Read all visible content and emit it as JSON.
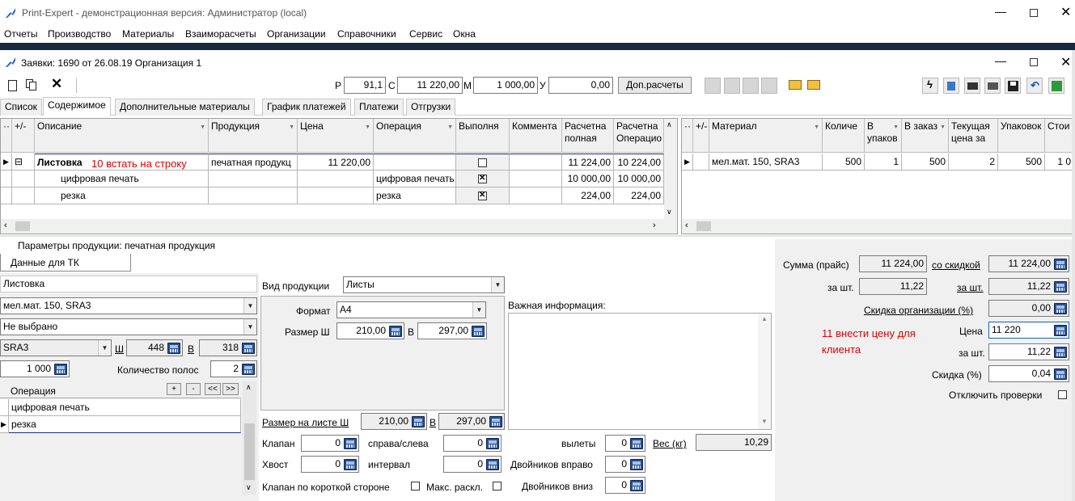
{
  "app_title": "Print-Expert - демонстрационная версия: Администратор (local)",
  "menu": [
    "Отчеты",
    "Производство",
    "Материалы",
    "Взаиморасчеты",
    "Организации",
    "Справочники",
    "Сервис",
    "Окна"
  ],
  "child_title": "Заявки: 1690 от 26.08.19  Организация 1",
  "toolbar": {
    "p_label": "Р",
    "p_value": "91,1",
    "c_label": "С",
    "c_value": "11 220,00",
    "m_label": "М",
    "m_value": "1 000,00",
    "u_label": "У",
    "u_value": "0,00",
    "dop_button": "Доп.расчеты"
  },
  "tabs": [
    "Список",
    "Содержимое",
    "Дополнительные материалы",
    "График платежей",
    "Платежи",
    "Отгрузки"
  ],
  "left_grid": {
    "headers": [
      "+/-",
      "Описание",
      "Продукция",
      "Цена",
      "Операция",
      "Выполня",
      "Коммента",
      "Расчетна полная",
      "Расчетна Операцио"
    ],
    "rows": [
      {
        "desc": "Листовка",
        "product": "печатная продукц",
        "price": "11 220,00",
        "op": "",
        "done": false,
        "calc_full": "11 224,00",
        "calc_op": "10 224,00"
      },
      {
        "desc": "цифровая печать",
        "product": "",
        "price": "",
        "op": "цифровая печать",
        "done": true,
        "calc_full": "10 000,00",
        "calc_op": "10 000,00"
      },
      {
        "desc": "резка",
        "product": "",
        "price": "",
        "op": "резка",
        "done": true,
        "calc_full": "224,00",
        "calc_op": "224,00"
      }
    ],
    "note": "10 встать на строку"
  },
  "right_grid": {
    "headers": [
      "+/-",
      "Материал",
      "Количе",
      "В упаков",
      "В заказ",
      "Текущая цена за",
      "Упаковок",
      "Стои"
    ],
    "rows": [
      {
        "material": "мел.мат. 150, SRA3",
        "qty": "500",
        "in_pack": "1",
        "in_order": "500",
        "price": "2",
        "packs": "500",
        "cost": "1 0"
      }
    ]
  },
  "params_title": "Параметры продукции: печатная продукция",
  "tk_tab": "Данные для ТК",
  "left_panel": {
    "name": "Листовка",
    "material": "мел.мат. 150, SRA3",
    "not_selected": "Не выбрано",
    "format": "SRA3",
    "w_label": "Ш",
    "w_value": "448",
    "h_label": "В",
    "h_value": "318",
    "qty": "1 000",
    "strips_label": "Количество полос",
    "strips_value": "2",
    "ops_header": "Операция",
    "ops_buttons": [
      "+",
      "-",
      "<<",
      ">>"
    ],
    "ops": [
      "цифровая печать",
      "резка"
    ]
  },
  "mid_panel": {
    "kind_label": "Вид продукции",
    "kind_value": "Листы",
    "format_label": "Формат",
    "format_value": "А4",
    "size_label": "Размер Ш",
    "size_w": "210,00",
    "size_h_label": "В",
    "size_h": "297,00",
    "important_label": "Важная информация:",
    "sheet_size_label": "Размер на листе Ш",
    "sheet_w": "210,00",
    "sheet_h_label": "В",
    "sheet_h": "297,00",
    "flap_label": "Клапан",
    "flap_value": "0",
    "side_label": "справа/слева",
    "side_value": "0",
    "bleed_label": "вылеты",
    "bleed_value": "0",
    "weight_label": "Вес (кг)",
    "weight_value": "10,29",
    "tail_label": "Хвост",
    "tail_value": "0",
    "interval_label": "интервал",
    "interval_value": "0",
    "twins_right_label": "Двойников вправо",
    "twins_right_value": "0",
    "short_side_label": "Клапан по короткой стороне",
    "max_layout_label": "Макс. раскл.",
    "twins_down_label": "Двойников вниз",
    "twins_down_value": "0"
  },
  "right_panel": {
    "sum_label": "Сумма (прайс)",
    "sum_value": "11 224,00",
    "discount_label": "со скидкой",
    "discount_value": "11 224,00",
    "per_pc_label": "за шт.",
    "per_pc_value": "11,22",
    "per_pc2_label": "за шт.",
    "per_pc2_value": "11,22",
    "org_discount_label": "Скидка организации (%)",
    "org_discount_value": "0,00",
    "note": "11  внести цену для клиента",
    "price_label": "Цена",
    "price_value": "11 220",
    "per_pc3_label": "за шт.",
    "per_pc3_value": "11,22",
    "disc_pct_label": "Скидка (%)",
    "disc_pct_value": "0,04",
    "disable_checks_label": "Отключить проверки"
  }
}
